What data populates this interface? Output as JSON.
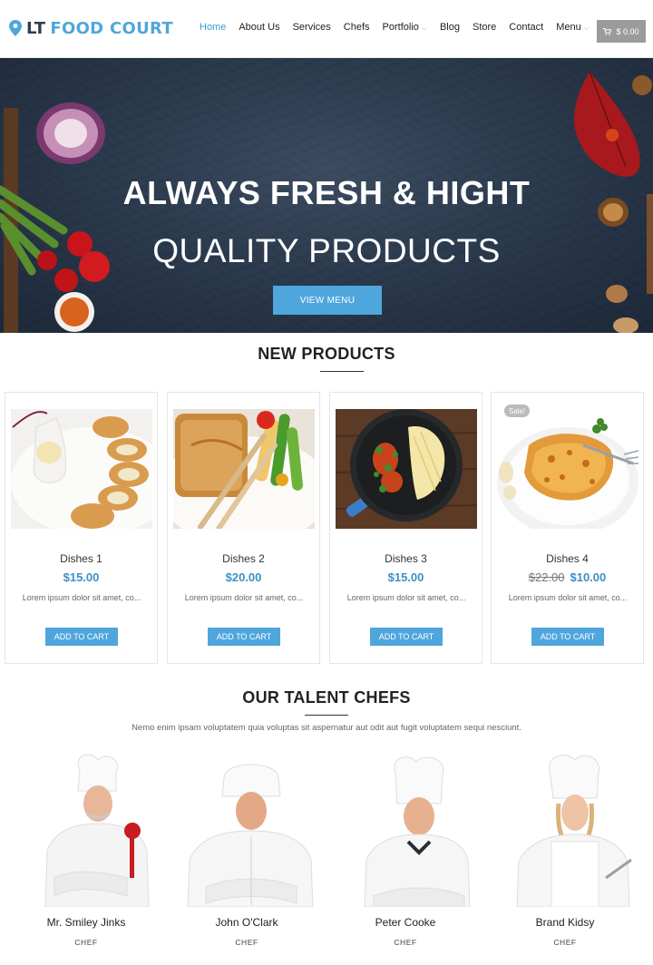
{
  "header": {
    "logo_prefix": "LT",
    "logo_name": "FOOD COURT",
    "nav": [
      {
        "label": "Home",
        "active": true
      },
      {
        "label": "About Us"
      },
      {
        "label": "Services"
      },
      {
        "label": "Chefs"
      },
      {
        "label": "Portfolio",
        "dropdown": true
      },
      {
        "label": "Blog"
      },
      {
        "label": "Store"
      },
      {
        "label": "Contact"
      },
      {
        "label": "Menu",
        "dropdown": true
      }
    ],
    "cart_total": "$ 0.00"
  },
  "hero": {
    "headline": "ALWAYS FRESH & HIGHT",
    "subheadline": "QUALITY PRODUCTS",
    "button_label": "VIEW MENU"
  },
  "products": {
    "title": "NEW PRODUCTS",
    "items": [
      {
        "name": "Dishes 1",
        "price": "$15.00",
        "desc": "Lorem ipsum dolor sit amet, co...",
        "button": "ADD TO CART"
      },
      {
        "name": "Dishes 2",
        "price": "$20.00",
        "desc": "Lorem ipsum dolor sit amet, co...",
        "button": "ADD TO CART"
      },
      {
        "name": "Dishes 3",
        "price": "$15.00",
        "desc": "Lorem ipsum dolor sit amet, co...",
        "button": "ADD TO CART"
      },
      {
        "name": "Dishes 4",
        "old_price": "$22.00",
        "price": "$10.00",
        "badge": "Sale!",
        "desc": "Lorem ipsum dolor sit amet, co...",
        "button": "ADD TO CART"
      }
    ]
  },
  "chefs": {
    "title": "OUR TALENT CHEFS",
    "intro": "Nemo enim ipsam voluptatem quia voluptas sit aspernatur aut odit aut fugit voluptatem sequi nesciunt.",
    "items": [
      {
        "name": "Mr. Smiley Jinks",
        "role": "CHEF"
      },
      {
        "name": "John O'Clark",
        "role": "CHEF"
      },
      {
        "name": "Peter Cooke",
        "role": "CHEF"
      },
      {
        "name": "Brand Kidsy",
        "role": "CHEF"
      }
    ]
  },
  "colors": {
    "accent": "#4ea6dc",
    "price": "#3d8fc7",
    "logo_dark": "#2d3e50",
    "hero_bg": "#2b3a4d"
  }
}
